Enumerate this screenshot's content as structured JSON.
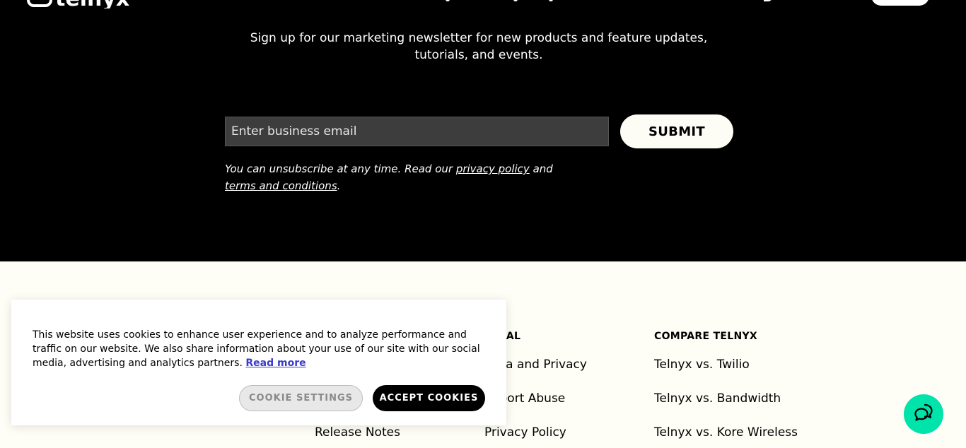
{
  "brand": {
    "logo_text": "telnyx"
  },
  "newsletter": {
    "description": "Sign up for our marketing newsletter for new products and feature updates, tutorials, and events.",
    "email_placeholder": "Enter business email",
    "submit_label": "SUBMIT",
    "disclaimer_prefix": "You can unsubscribe at any time. Read our ",
    "privacy_link": "privacy policy",
    "disclaimer_and": " and ",
    "terms_link": "terms and conditions",
    "disclaimer_suffix": "."
  },
  "footer": {
    "columns": [
      {
        "heading": "",
        "links": [
          "",
          "",
          "Release Notes"
        ]
      },
      {
        "heading": "LEGAL",
        "links": [
          "Data and Privacy",
          "Report Abuse",
          "Privacy Policy"
        ]
      },
      {
        "heading": "COMPARE TELNYX",
        "links": [
          "Telnyx vs. Twilio",
          "Telnyx vs. Bandwidth",
          "Telnyx vs. Kore Wireless"
        ]
      }
    ]
  },
  "cookie_banner": {
    "text": "This website uses cookies to enhance user experience and to analyze performance and traffic on our website. We also share information about your use of our site with our social media, advertising and analytics partners.",
    "read_more": "Read more",
    "settings_label": "COOKIE SETTINGS",
    "accept_label": "ACCEPT COOKIES"
  },
  "chat": {
    "icon": "chat-bubbles-icon"
  },
  "colors": {
    "hero_bg": "#000000",
    "footer_bg": "#fefdf6",
    "chat_accent": "#00e3aa",
    "link_blue": "#3a3acb"
  }
}
